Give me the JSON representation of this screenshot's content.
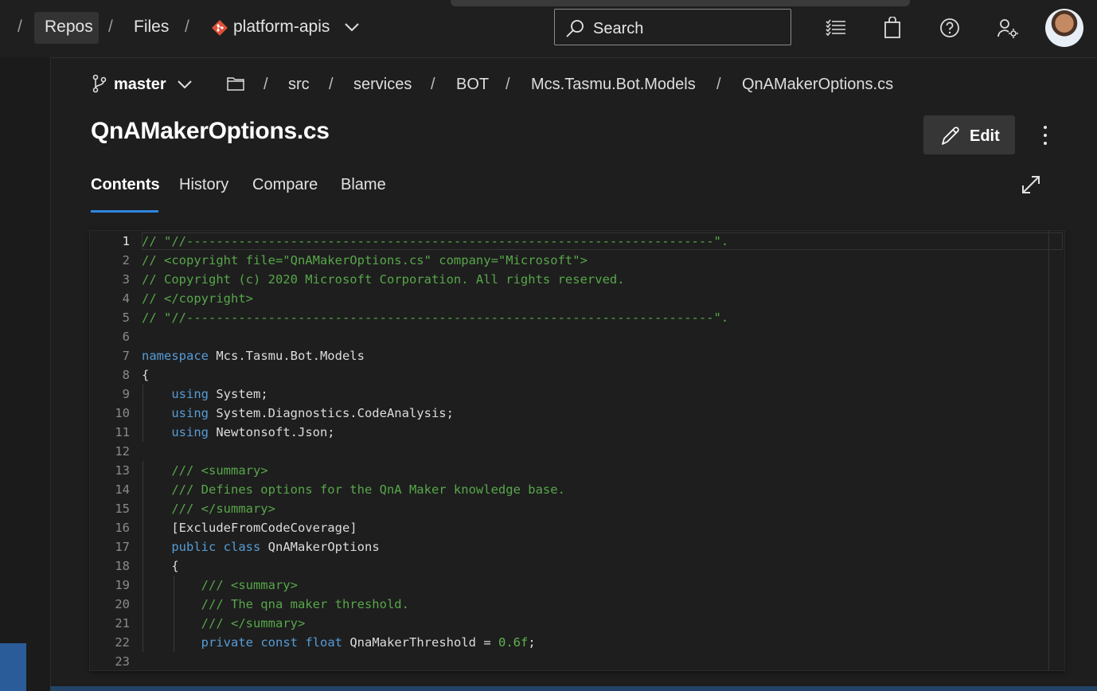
{
  "topbar": {
    "crumbs": {
      "repos": "Repos",
      "files": "Files",
      "repo": "platform-apis"
    },
    "search_placeholder": "Search"
  },
  "path": {
    "branch": "master",
    "segments": [
      "src",
      "services",
      "BOT",
      "Mcs.Tasmu.Bot.Models",
      "QnAMakerOptions.cs"
    ]
  },
  "file": {
    "title": "QnAMakerOptions.cs",
    "edit_label": "Edit"
  },
  "tabs": [
    "Contents",
    "History",
    "Compare",
    "Blame"
  ],
  "colors": {
    "comment": "#57a64a",
    "keyword": "#569cd6",
    "number": "#5eb34c",
    "accent": "#2f86e0"
  },
  "code": [
    {
      "n": "1",
      "tokens": [
        [
          "c",
          "// \"//-----------------------------------------------------------------------\"."
        ]
      ]
    },
    {
      "n": "2",
      "tokens": [
        [
          "c",
          "// <copyright file=\"QnAMakerOptions.cs\" company=\"Microsoft\">"
        ]
      ]
    },
    {
      "n": "3",
      "tokens": [
        [
          "c",
          "// Copyright (c) 2020 Microsoft Corporation. All rights reserved."
        ]
      ]
    },
    {
      "n": "4",
      "tokens": [
        [
          "c",
          "// </copyright>"
        ]
      ]
    },
    {
      "n": "5",
      "tokens": [
        [
          "c",
          "// \"//-----------------------------------------------------------------------\"."
        ]
      ]
    },
    {
      "n": "6",
      "tokens": []
    },
    {
      "n": "7",
      "tokens": [
        [
          "k",
          "namespace"
        ],
        [
          "p",
          " Mcs.Tasmu.Bot.Models"
        ]
      ]
    },
    {
      "n": "8",
      "tokens": [
        [
          "p",
          "{"
        ]
      ]
    },
    {
      "n": "9",
      "tokens": [
        [
          "p",
          "    "
        ],
        [
          "k",
          "using"
        ],
        [
          "p",
          " System;"
        ]
      ]
    },
    {
      "n": "10",
      "tokens": [
        [
          "p",
          "    "
        ],
        [
          "k",
          "using"
        ],
        [
          "p",
          " System.Diagnostics.CodeAnalysis;"
        ]
      ]
    },
    {
      "n": "11",
      "tokens": [
        [
          "p",
          "    "
        ],
        [
          "k",
          "using"
        ],
        [
          "p",
          " Newtonsoft.Json;"
        ]
      ]
    },
    {
      "n": "12",
      "tokens": []
    },
    {
      "n": "13",
      "tokens": [
        [
          "p",
          "    "
        ],
        [
          "c",
          "/// <summary>"
        ]
      ]
    },
    {
      "n": "14",
      "tokens": [
        [
          "p",
          "    "
        ],
        [
          "c",
          "/// Defines options for the QnA Maker knowledge base."
        ]
      ]
    },
    {
      "n": "15",
      "tokens": [
        [
          "p",
          "    "
        ],
        [
          "c",
          "/// </summary>"
        ]
      ]
    },
    {
      "n": "16",
      "tokens": [
        [
          "p",
          "    [ExcludeFromCodeCoverage]"
        ]
      ]
    },
    {
      "n": "17",
      "tokens": [
        [
          "p",
          "    "
        ],
        [
          "k",
          "public"
        ],
        [
          "p",
          " "
        ],
        [
          "k",
          "class"
        ],
        [
          "p",
          " QnAMakerOptions"
        ]
      ]
    },
    {
      "n": "18",
      "tokens": [
        [
          "p",
          "    {"
        ]
      ]
    },
    {
      "n": "19",
      "tokens": [
        [
          "p",
          "        "
        ],
        [
          "c",
          "/// <summary>"
        ]
      ]
    },
    {
      "n": "20",
      "tokens": [
        [
          "p",
          "        "
        ],
        [
          "c",
          "/// The qna maker threshold."
        ]
      ]
    },
    {
      "n": "21",
      "tokens": [
        [
          "p",
          "        "
        ],
        [
          "c",
          "/// </summary>"
        ]
      ]
    },
    {
      "n": "22",
      "tokens": [
        [
          "p",
          "        "
        ],
        [
          "k",
          "private"
        ],
        [
          "p",
          " "
        ],
        [
          "k",
          "const"
        ],
        [
          "p",
          " "
        ],
        [
          "k",
          "float"
        ],
        [
          "p",
          " QnaMakerThreshold = "
        ],
        [
          "n",
          "0.6f"
        ],
        [
          "p",
          ";"
        ]
      ]
    },
    {
      "n": "23",
      "tokens": []
    }
  ]
}
